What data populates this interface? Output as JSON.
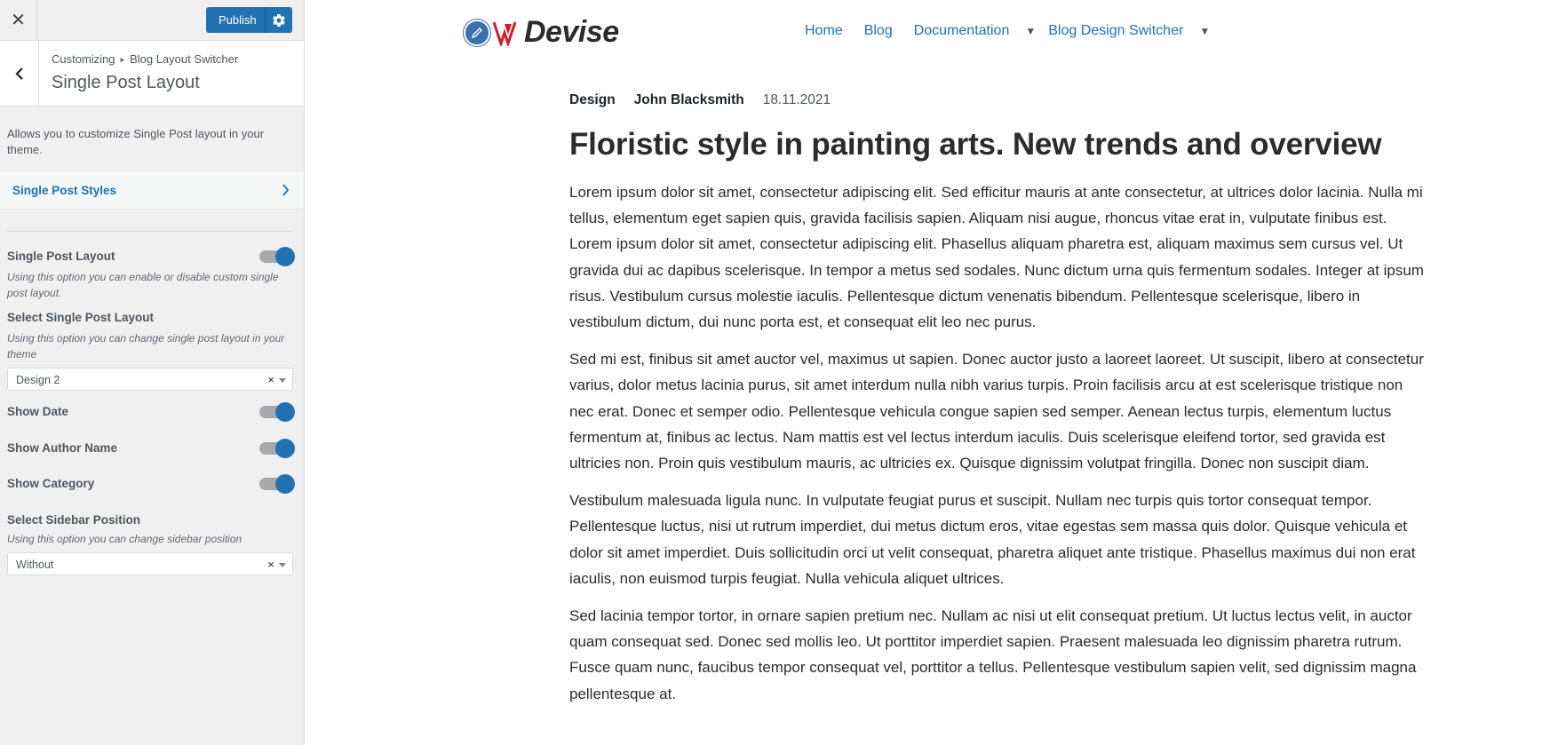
{
  "topbar": {
    "close_glyph": "✕",
    "publish_label": "Publish"
  },
  "section": {
    "breadcrumb_root": "Customizing",
    "breadcrumb_parent": "Blog Layout Switcher",
    "title": "Single Post Layout",
    "description": "Allows you to customize Single Post layout in your theme."
  },
  "subsection": {
    "label": "Single Post Styles"
  },
  "controls": {
    "single_post_layout": {
      "label": "Single Post Layout",
      "description": "Using this option you can enable or disable custom single post layout.",
      "enabled": true
    },
    "select_layout": {
      "label": "Select Single Post Layout",
      "description": "Using this option you can change single post layout in your theme",
      "value": "Design 2"
    },
    "show_date": {
      "label": "Show Date",
      "enabled": true
    },
    "show_author": {
      "label": "Show Author Name",
      "enabled": true
    },
    "show_category": {
      "label": "Show Category",
      "enabled": true
    },
    "sidebar_position": {
      "label": "Select Sidebar Position",
      "description": "Using this option you can change sidebar position",
      "value": "Without"
    },
    "clear_glyph": "×"
  },
  "site": {
    "logo_text": "Devise",
    "nav": {
      "home": "Home",
      "blog": "Blog",
      "documentation": "Documentation",
      "switcher": "Blog Design Switcher",
      "caret": "▼"
    }
  },
  "post": {
    "category": "Design",
    "author": "John Blacksmith",
    "date": "18.11.2021",
    "title": "Floristic style in painting arts. New trends and overview",
    "paragraphs": [
      "Lorem ipsum dolor sit amet, consectetur adipiscing elit. Sed efficitur mauris at ante consectetur, at ultrices dolor lacinia. Nulla mi tellus, elementum eget sapien quis, gravida facilisis sapien. Aliquam nisi augue, rhoncus vitae erat in, vulputate finibus est. Lorem ipsum dolor sit amet, consectetur adipiscing elit. Phasellus aliquam pharetra est, aliquam maximus sem cursus vel. Ut gravida dui ac dapibus scelerisque. In tempor a metus sed sodales. Nunc dictum urna quis fermentum sodales. Integer at ipsum risus. Vestibulum cursus molestie iaculis. Pellentesque dictum venenatis bibendum. Pellentesque scelerisque, libero in vestibulum dictum, dui nunc porta est, et consequat elit leo nec purus.",
      "Sed mi est, finibus sit amet auctor vel, maximus ut sapien. Donec auctor justo a laoreet laoreet. Ut suscipit, libero at consectetur varius, dolor metus lacinia purus, sit amet interdum nulla nibh varius turpis. Proin facilisis arcu at est scelerisque tristique non nec erat. Donec et semper odio. Pellentesque vehicula congue sapien sed semper. Aenean lectus turpis, elementum luctus fermentum at, finibus ac lectus. Nam mattis est vel lectus interdum iaculis. Duis scelerisque eleifend tortor, sed gravida est ultricies non. Proin quis vestibulum mauris, ac ultricies ex. Quisque dignissim volutpat fringilla. Donec non suscipit diam.",
      "Vestibulum malesuada ligula nunc. In vulputate feugiat purus et suscipit. Nullam nec turpis quis tortor consequat tempor. Pellentesque luctus, nisi ut rutrum imperdiet, dui metus dictum eros, vitae egestas sem massa quis dolor. Quisque vehicula et dolor sit amet imperdiet. Duis sollicitudin orci ut velit consequat, pharetra aliquet ante tristique. Phasellus maximus dui non erat iaculis, non euismod turpis feugiat. Nulla vehicula aliquet ultrices.",
      "Sed lacinia tempor tortor, in ornare sapien pretium nec. Nullam ac nisi ut elit consequat pretium. Ut luctus lectus velit, in auctor quam consequat sed. Donec sed mollis leo. Ut porttitor imperdiet sapien. Praesent malesuada leo dignissim pharetra rutrum. Fusce quam nunc, faucibus tempor consequat vel, porttitor a tellus. Pellentesque vestibulum sapien velit, sed dignissim magna pellentesque at."
    ]
  },
  "colors": {
    "accent": "#2271b1",
    "sidebar_bg": "#f0f0f1",
    "toggle_track": "#a7aaad",
    "logo_red": "#d21b2a"
  }
}
